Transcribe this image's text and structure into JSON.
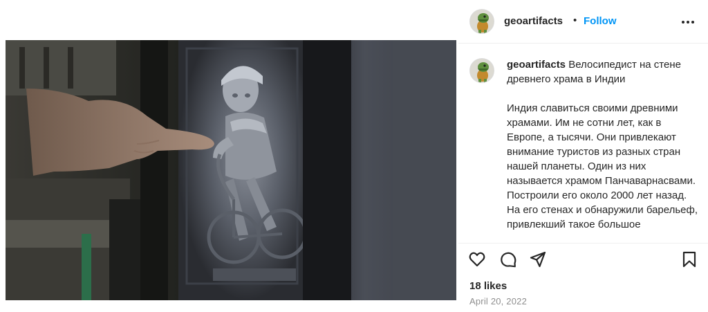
{
  "post": {
    "image_alt": "Велосипедист на стене древнего храма в Индии"
  },
  "header": {
    "username": "geoartifacts",
    "separator": "•",
    "follow_label": "Follow"
  },
  "caption": {
    "username": "geoartifacts",
    "title": "Велосипедист на стене древнего храма в Индии",
    "body": "Индия славиться своими древними храмами. Им не сотни лет, как в Европе, а тысячи. Они привлекают внимание туристов из разных стран нашей планеты. Один из них называется храмом Панчаварнасвами. Построили его около 2000 лет назад. На его стенах и обнаружили барельеф, привлекший такое большое"
  },
  "stats": {
    "likes": "18 likes",
    "date": "April 20, 2022"
  },
  "icons": {
    "like": "heart-icon",
    "comment": "comment-icon",
    "share": "paper-plane-icon",
    "save": "bookmark-icon",
    "more": "more-options-icon"
  },
  "colors": {
    "accent": "#0095f6",
    "text": "#262626",
    "muted": "#8e8e8e",
    "divider": "#efefef"
  }
}
